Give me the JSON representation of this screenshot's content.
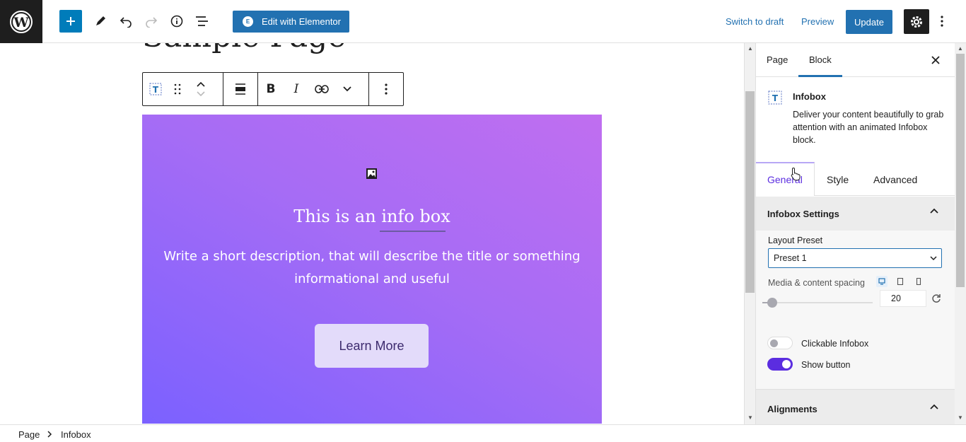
{
  "topbar": {
    "elementor_label": "Edit with Elementor",
    "switch_to_draft": "Switch to draft",
    "preview": "Preview",
    "update": "Update"
  },
  "canvas": {
    "page_title": "Sample Page",
    "infobox": {
      "title": "This is an info box",
      "description": "Write a short description, that will describe the title or something informational and useful",
      "button_label": "Learn More"
    }
  },
  "sidebar": {
    "tabs": [
      "Page",
      "Block"
    ],
    "active_tab": "Block",
    "block": {
      "name": "Infobox",
      "description": "Deliver your content beautifully to grab attention with an animated Infobox block."
    },
    "inner_tabs": [
      "General",
      "Style",
      "Advanced"
    ],
    "active_inner_tab": "General",
    "infobox_settings": {
      "header": "Infobox Settings",
      "layout_preset_label": "Layout Preset",
      "layout_preset_value": "Preset 1",
      "spacing_label": "Media & content spacing",
      "spacing_value": "20",
      "clickable_label": "Clickable Infobox",
      "clickable_on": false,
      "show_button_label": "Show button",
      "show_button_on": true
    },
    "alignments_header": "Alignments"
  },
  "breadcrumb": [
    "Page",
    "Infobox"
  ],
  "colors": {
    "wp_blue": "#2271b1",
    "toggle_on": "#5b2de0",
    "infobox_gradient_start": "#7b61ff",
    "infobox_gradient_end": "#c06ef0"
  }
}
